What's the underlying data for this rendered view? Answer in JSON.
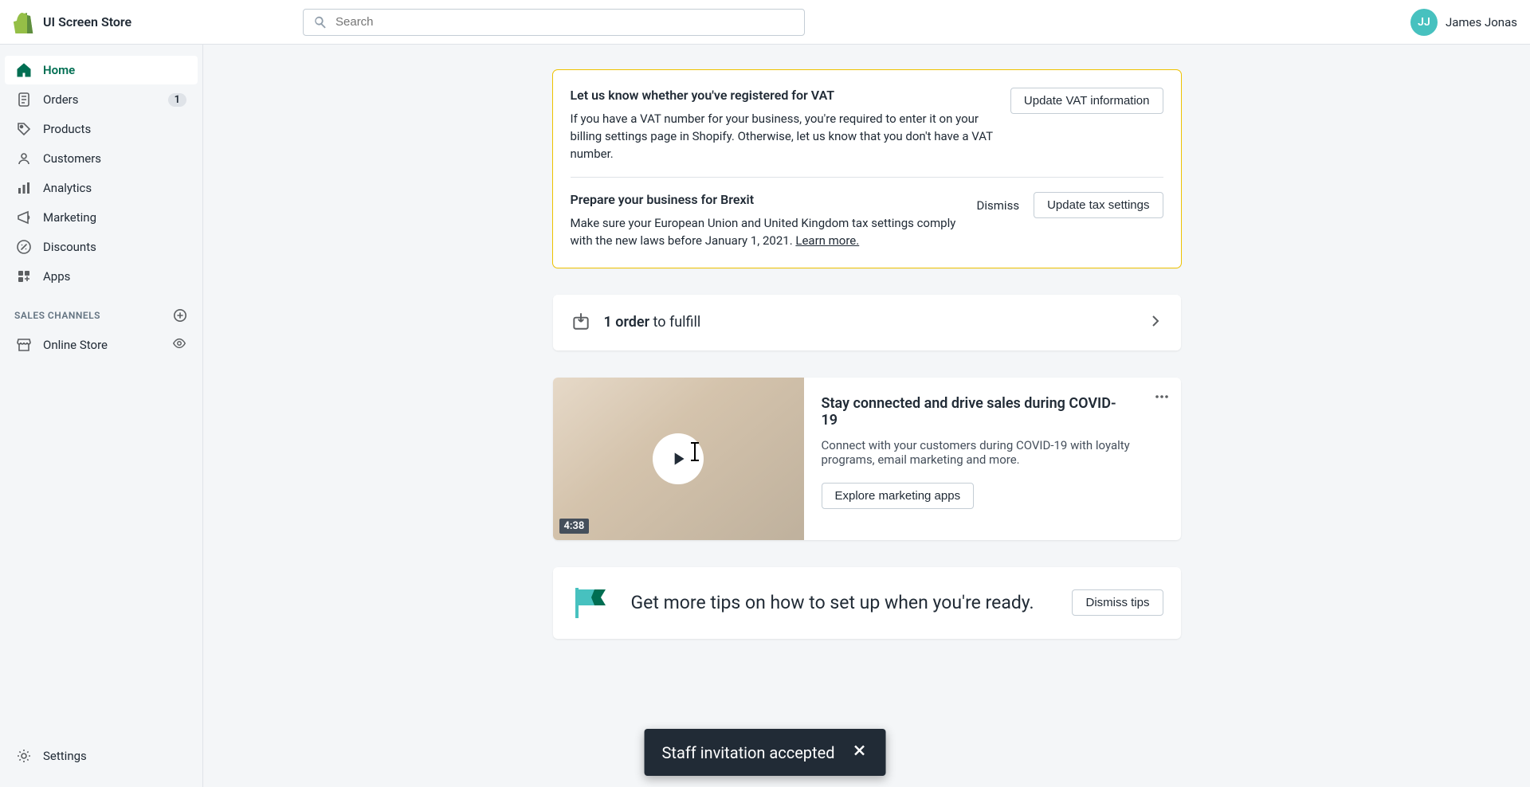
{
  "topbar": {
    "store_name": "UI Screen Store",
    "search_placeholder": "Search",
    "user_initials": "JJ",
    "user_name": "James Jonas"
  },
  "sidebar": {
    "items": [
      {
        "label": "Home",
        "icon": "home-icon",
        "active": true
      },
      {
        "label": "Orders",
        "icon": "orders-icon",
        "badge": "1"
      },
      {
        "label": "Products",
        "icon": "products-icon"
      },
      {
        "label": "Customers",
        "icon": "customers-icon"
      },
      {
        "label": "Analytics",
        "icon": "analytics-icon"
      },
      {
        "label": "Marketing",
        "icon": "marketing-icon"
      },
      {
        "label": "Discounts",
        "icon": "discounts-icon"
      },
      {
        "label": "Apps",
        "icon": "apps-icon"
      }
    ],
    "section_sales_channels": "SALES CHANNELS",
    "channel_items": [
      {
        "label": "Online Store",
        "icon": "online-store-icon"
      }
    ],
    "settings_label": "Settings"
  },
  "vat_banner": {
    "title": "Let us know whether you've registered for VAT",
    "body": "If you have a VAT number for your business, you're required to enter it on your billing settings page in Shopify. Otherwise, let us know that you don't have a VAT number.",
    "button": "Update VAT information"
  },
  "brexit_banner": {
    "title": "Prepare your business for Brexit",
    "body_prefix": "Make sure your European Union and United Kingdom tax settings comply with the new laws before January 1, 2021. ",
    "learn_more": "Learn more.",
    "dismiss": "Dismiss",
    "button": "Update tax settings"
  },
  "fulfill": {
    "count": "1 order",
    "suffix": " to fulfill"
  },
  "covid": {
    "duration": "4:38",
    "title": "Stay connected and drive sales during COVID-19",
    "body": "Connect with your customers during COVID-19 with loyalty programs, email marketing and more.",
    "button": "Explore marketing apps"
  },
  "tips": {
    "title": "Get more tips on how to set up when you're ready.",
    "dismiss_button": "Dismiss tips"
  },
  "toast": {
    "message": "Staff invitation accepted"
  }
}
